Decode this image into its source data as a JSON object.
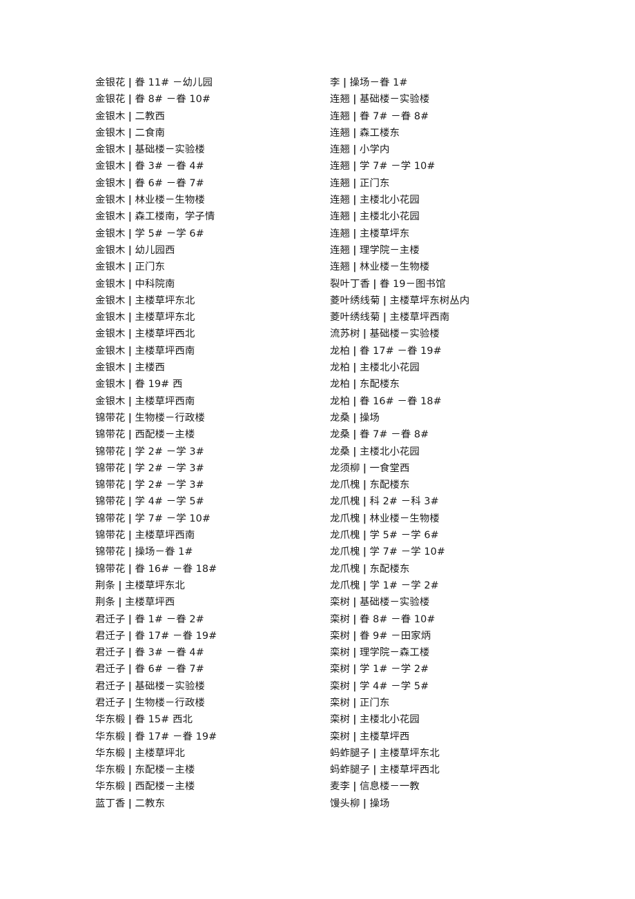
{
  "document": {
    "type": "plant-location-listing",
    "separator": "|",
    "columns": [
      {
        "id": "left",
        "entries": [
          {
            "name": "金银花",
            "location": "眷 11# －幼儿园"
          },
          {
            "name": "金银花",
            "location": "眷 8# －眷 10#"
          },
          {
            "name": "金银木",
            "location": "二教西"
          },
          {
            "name": "金银木",
            "location": "二食南"
          },
          {
            "name": "金银木",
            "location": "基础楼－实验楼"
          },
          {
            "name": "金银木",
            "location": "眷 3# －眷 4#"
          },
          {
            "name": "金银木",
            "location": "眷 6# －眷 7#"
          },
          {
            "name": "金银木",
            "location": "林业楼－生物楼"
          },
          {
            "name": "金银木",
            "location": "森工楼南，学子情"
          },
          {
            "name": "金银木",
            "location": "学 5# －学 6#"
          },
          {
            "name": "金银木",
            "location": "幼儿园西"
          },
          {
            "name": "金银木",
            "location": "正门东"
          },
          {
            "name": "金银木",
            "location": "中科院南"
          },
          {
            "name": "金银木",
            "location": "主楼草坪东北"
          },
          {
            "name": "金银木",
            "location": "主楼草坪东北"
          },
          {
            "name": "金银木",
            "location": "主楼草坪西北"
          },
          {
            "name": "金银木",
            "location": "主楼草坪西南"
          },
          {
            "name": "金银木",
            "location": "主楼西"
          },
          {
            "name": "金银木",
            "location": "眷 19# 西"
          },
          {
            "name": "金银木",
            "location": "主楼草坪西南"
          },
          {
            "name": "锦带花",
            "location": "生物楼－行政楼"
          },
          {
            "name": "锦带花",
            "location": "西配楼－主楼"
          },
          {
            "name": "锦带花",
            "location": "学 2# －学 3#"
          },
          {
            "name": "锦带花",
            "location": "学 2# －学 3#"
          },
          {
            "name": "锦带花",
            "location": "学 2# －学 3#"
          },
          {
            "name": "锦带花",
            "location": "学 4# －学 5#"
          },
          {
            "name": "锦带花",
            "location": "学 7# －学 10#"
          },
          {
            "name": "锦带花",
            "location": "主楼草坪西南"
          },
          {
            "name": "锦带花",
            "location": "操场－眷 1#"
          },
          {
            "name": "锦带花",
            "location": "眷 16# －眷 18#"
          },
          {
            "name": "荆条",
            "location": "主楼草坪东北"
          },
          {
            "name": "荆条",
            "location": "主楼草坪西"
          },
          {
            "name": "君迁子",
            "location": "眷 1# －眷 2#"
          },
          {
            "name": "君迁子",
            "location": "眷 17# －眷 19#"
          },
          {
            "name": "君迁子",
            "location": "眷 3# －眷 4#"
          },
          {
            "name": "君迁子",
            "location": "眷 6# －眷 7#"
          },
          {
            "name": "君迁子",
            "location": "基础楼－实验楼"
          },
          {
            "name": "君迁子",
            "location": "生物楼－行政楼"
          },
          {
            "name": "华东椴",
            "location": "眷 15# 西北"
          },
          {
            "name": "华东椴",
            "location": "眷 17# －眷 19#"
          },
          {
            "name": "华东椴",
            "location": "主楼草坪北"
          },
          {
            "name": "华东椴",
            "location": "东配楼－主楼"
          },
          {
            "name": "华东椴",
            "location": "西配楼－主楼"
          },
          {
            "name": "蓝丁香",
            "location": "二教东"
          }
        ]
      },
      {
        "id": "right",
        "entries": [
          {
            "name": "李",
            "location": "操场－眷 1#"
          },
          {
            "name": "连翘",
            "location": "基础楼－实验楼"
          },
          {
            "name": "连翘",
            "location": "眷 7# －眷 8#"
          },
          {
            "name": "连翘",
            "location": "森工楼东"
          },
          {
            "name": "连翘",
            "location": "小学内"
          },
          {
            "name": "连翘",
            "location": "学 7# －学 10#"
          },
          {
            "name": "连翘",
            "location": "正门东"
          },
          {
            "name": "连翘",
            "location": "主楼北小花园"
          },
          {
            "name": "连翘",
            "location": "主楼北小花园"
          },
          {
            "name": "连翘",
            "location": "主楼草坪东"
          },
          {
            "name": "连翘",
            "location": "理学院－主楼"
          },
          {
            "name": "连翘",
            "location": "林业楼－生物楼"
          },
          {
            "name": "裂叶丁香",
            "location": "眷 19－图书馆"
          },
          {
            "name": "菱叶绣线菊",
            "location": "主楼草坪东树丛内"
          },
          {
            "name": "菱叶绣线菊",
            "location": "主楼草坪西南"
          },
          {
            "name": "流苏树",
            "location": "基础楼－实验楼"
          },
          {
            "name": "龙柏",
            "location": "眷 17# －眷 19#"
          },
          {
            "name": "龙柏",
            "location": "主楼北小花园"
          },
          {
            "name": "龙柏",
            "location": "东配楼东"
          },
          {
            "name": "龙柏",
            "location": "眷 16# －眷 18#"
          },
          {
            "name": "龙桑",
            "location": "操场"
          },
          {
            "name": "龙桑",
            "location": "眷 7# －眷 8#"
          },
          {
            "name": "龙桑",
            "location": "主楼北小花园"
          },
          {
            "name": "龙须柳",
            "location": "一食堂西"
          },
          {
            "name": "龙爪槐",
            "location": "东配楼东"
          },
          {
            "name": "龙爪槐",
            "location": "科 2# －科 3#"
          },
          {
            "name": "龙爪槐",
            "location": "林业楼－生物楼"
          },
          {
            "name": "龙爪槐",
            "location": "学 5# －学 6#"
          },
          {
            "name": "龙爪槐",
            "location": "学 7# －学 10#"
          },
          {
            "name": "龙爪槐",
            "location": "东配楼东"
          },
          {
            "name": "龙爪槐",
            "location": "学 1# －学 2#"
          },
          {
            "name": "栾树",
            "location": "基础楼－实验楼"
          },
          {
            "name": "栾树",
            "location": "眷 8# －眷 10#"
          },
          {
            "name": "栾树",
            "location": "眷 9# －田家炳"
          },
          {
            "name": "栾树",
            "location": "理学院－森工楼"
          },
          {
            "name": "栾树",
            "location": "学 1# －学 2#"
          },
          {
            "name": "栾树",
            "location": "学 4# －学 5#"
          },
          {
            "name": "栾树",
            "location": "正门东"
          },
          {
            "name": "栾树",
            "location": "主楼北小花园"
          },
          {
            "name": "栾树",
            "location": "主楼草坪西"
          },
          {
            "name": "蚂蚱腿子",
            "location": "主楼草坪东北"
          },
          {
            "name": "蚂蚱腿子",
            "location": "主楼草坪西北"
          },
          {
            "name": "麦李",
            "location": "信息楼－一教"
          },
          {
            "name": "馒头柳",
            "location": "操场"
          }
        ]
      }
    ]
  }
}
